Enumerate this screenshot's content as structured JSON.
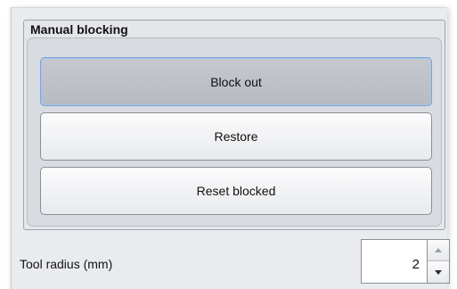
{
  "manual_blocking": {
    "title": "Manual blocking",
    "buttons": {
      "block_out": "Block out",
      "restore": "Restore",
      "reset_blocked": "Reset blocked"
    }
  },
  "tool_radius": {
    "label": "Tool radius (mm)",
    "value": "2"
  },
  "colors": {
    "panel_bg": "#e9ebef",
    "pressed_button": "#bfc2c8",
    "focus_outline": "#7aa4d6"
  },
  "icons": {
    "spin_up": "triangle-up-icon",
    "spin_down": "triangle-down-icon"
  }
}
